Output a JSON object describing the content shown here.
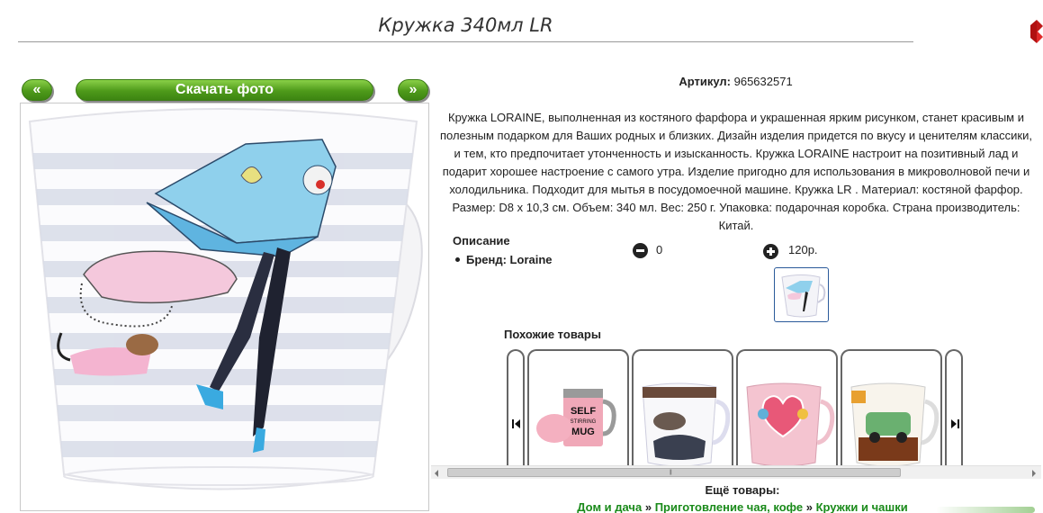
{
  "header": {
    "title": "Кружка 340мл LR"
  },
  "photo_nav": {
    "prev_label": "«",
    "download_label": "Скачать фото",
    "next_label": "»"
  },
  "product": {
    "article_label": "Артикул:",
    "article_value": "965632571",
    "description": "Кружка LORAINE, выполненная из костяного фарфора и украшенная ярким рисунком, станет красивым и полезным подарком для Ваших родных и близких. Дизайн изделия придется по вкусу и ценителям классики, и тем, кто предпочитает утонченность и изысканность. Кружка LORAINE настроит на позитивный лад и подарит хорошее настроение с самого утра. Изделие пригодно для использования в микроволновой печи и холодильника. Подходит для мытья в посудомоечной машине. Кружка LR . Материал: костяной фарфор. Размер: D8 х 10,3 см. Объем: 340 мл. Вес: 250 г. Упаковка: подарочная коробка. Страна производитель: Китай.",
    "description_heading": "Описание",
    "brand_line": "Бренд: Loraine",
    "quantity": "0",
    "price": "120р."
  },
  "similar": {
    "heading": "Похожие товары",
    "cards": [
      {
        "caption_art": [
          "SELF",
          "STIRRING",
          "MUG"
        ]
      },
      {
        "caption_art": []
      },
      {
        "caption_art": []
      },
      {
        "caption_art": []
      }
    ]
  },
  "footer": {
    "more_heading": "Ещё товары:",
    "breadcrumbs": [
      "Дом и дача",
      "Приготовление чая, кофе",
      "Кружки и чашки"
    ],
    "separator": "»"
  },
  "colors": {
    "accent_green": "#4e9a1a",
    "link_green": "#1a8a1a",
    "close_red": "#d42020"
  },
  "icons": [
    "close-icon",
    "minus-icon",
    "plus-icon",
    "first-icon",
    "last-icon",
    "scroll-left-icon",
    "scroll-right-icon"
  ]
}
